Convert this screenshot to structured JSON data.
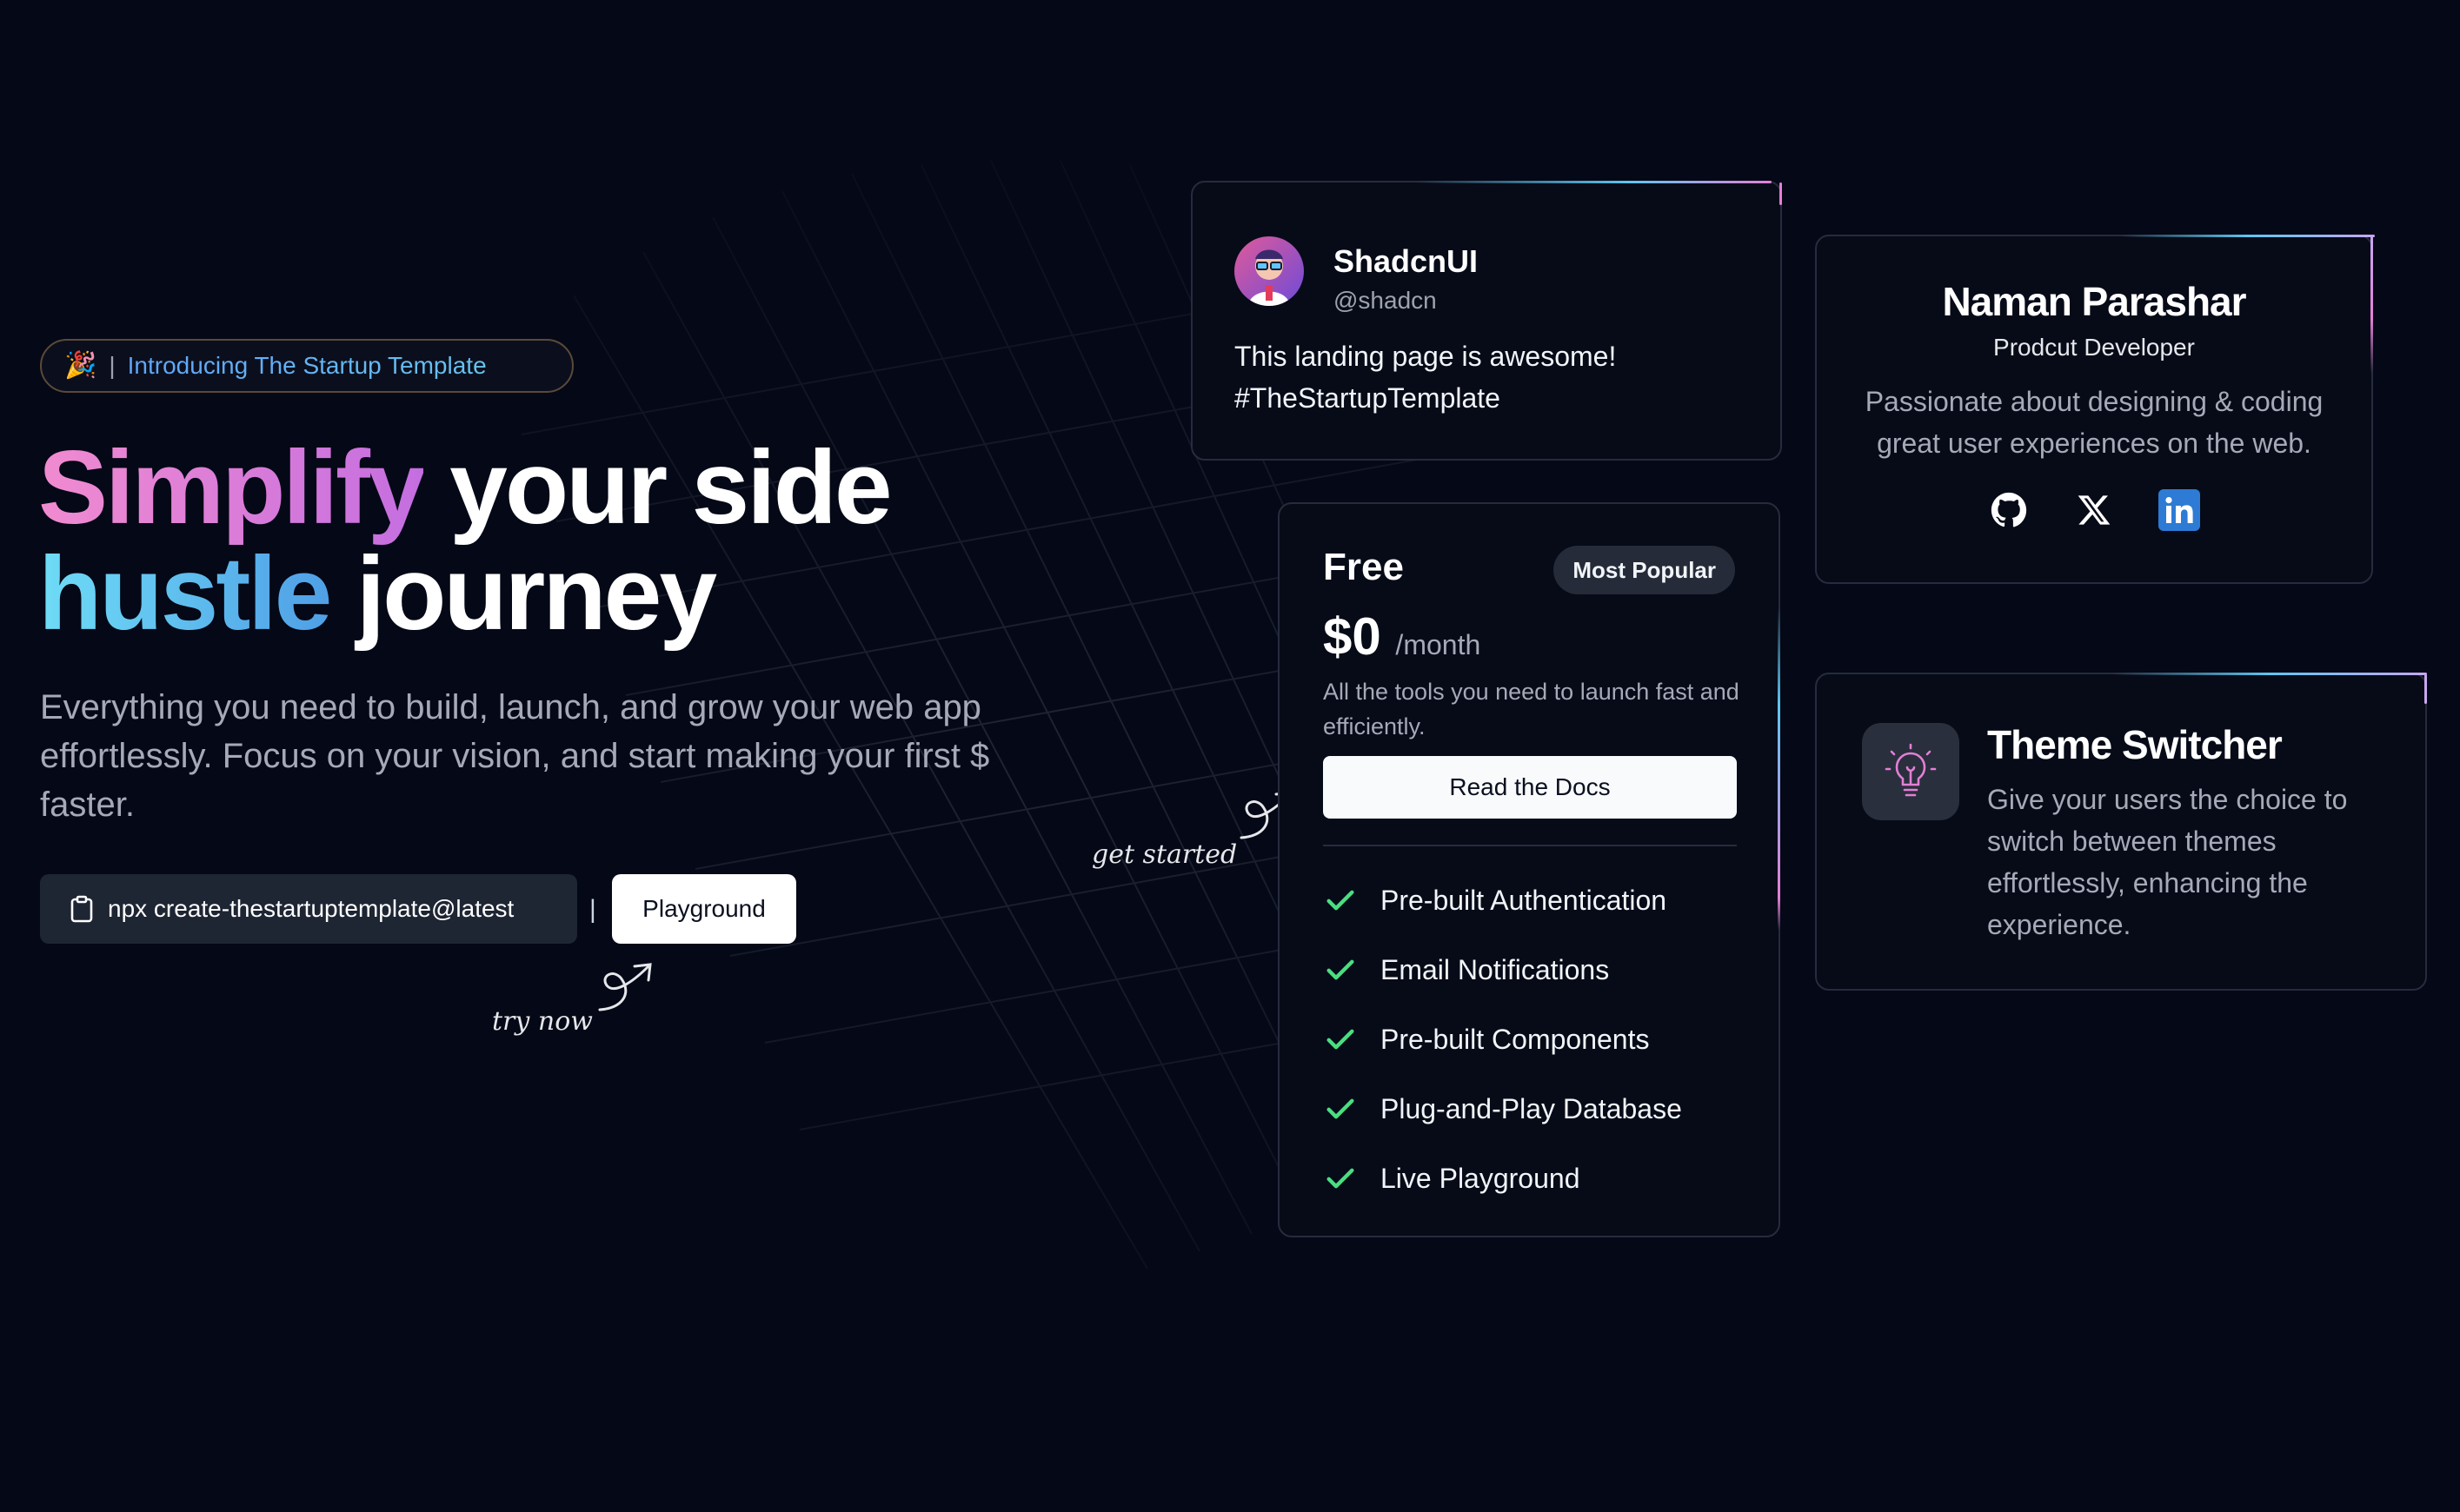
{
  "announcement": {
    "emoji": "🎉",
    "separator": "|",
    "text": "Introducing The Startup Template"
  },
  "hero": {
    "title_accent_1": "Simplify",
    "title_rest_1": " your side",
    "title_accent_2": "hustle",
    "title_rest_2": " journey",
    "subtitle": "Everything you need to build, launch, and grow your web app effortlessly. Focus on your vision, and start making your first $ faster."
  },
  "cta": {
    "command": "npx create-thestartuptemplate@latest",
    "separator": "|",
    "playground_label": "Playground",
    "try_now": "try now",
    "get_started": "get started"
  },
  "tweet": {
    "name": "ShadcnUI",
    "handle": "@shadcn",
    "text": "This landing page is awesome! #TheStartupTemplate"
  },
  "profile": {
    "name": "Naman Parashar",
    "role": "Prodcut Developer",
    "bio": "Passionate about designing & coding great user experiences on the web.",
    "socials": [
      "github-icon",
      "x-icon",
      "linkedin-icon"
    ]
  },
  "pricing": {
    "plan": "Free",
    "badge": "Most Popular",
    "price": "$0",
    "period": "/month",
    "description": "All the tools you need to launch fast and efficiently.",
    "button": "Read the Docs",
    "features": [
      "Pre-built Authentication",
      "Email Notifications",
      "Pre-built Components",
      "Plug-and-Play Database",
      "Live Playground"
    ]
  },
  "theme": {
    "title": "Theme Switcher",
    "description": "Give your users the choice to switch between themes effortlessly, enhancing the experience."
  },
  "colors": {
    "background": "#050816",
    "pink_accent": "#e47fd6",
    "blue_accent": "#5ec6f0",
    "check_green": "#4ade80",
    "linkedin": "#2d7bd4"
  }
}
